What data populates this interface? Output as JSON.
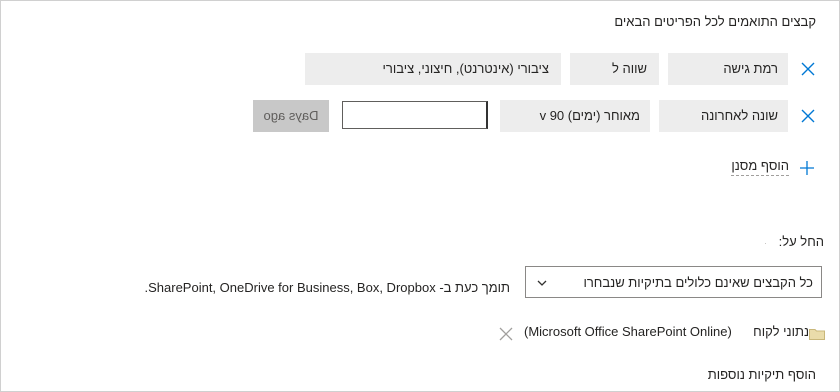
{
  "header": {
    "title": "קבצים התואמים לכל הפריטים הבאים"
  },
  "filters": [
    {
      "field": "רמת גישה",
      "operator": "שווה ל",
      "value": "ציבורי (אינטרנט), חיצוני, ציבורי"
    },
    {
      "field": "שונה לאחרונה",
      "operator": "מאוחר (ימים) 90 v",
      "value_input": "",
      "value_suffix": "Days ago"
    }
  ],
  "add_filter": {
    "label": "הוסף מסנן"
  },
  "apply_to": {
    "label": "החל על:",
    "dropdown": {
      "selected": "כל הקבצים שאינם כלולים בתיקיות שנבחרו"
    },
    "support_note": "תומך כעת ב- SharePoint, OneDrive for Business, Box, Dropbox."
  },
  "folders": [
    {
      "name": "נתוני לקוח",
      "source": "(Microsoft Office SharePoint Online)"
    }
  ],
  "add_folders": {
    "label": "הוסף תיקיות נוספות"
  },
  "colors": {
    "accent": "#0078d4",
    "field_bg": "#ededed",
    "folder": "#e8d9a8"
  }
}
